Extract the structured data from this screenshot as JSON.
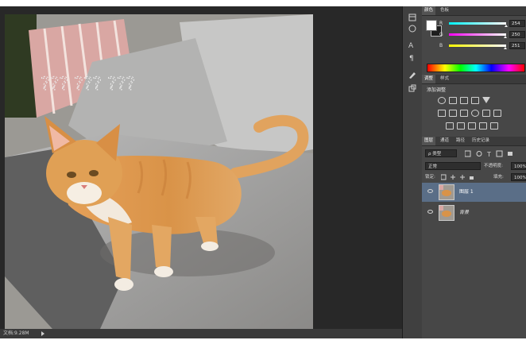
{
  "status": {
    "zoom_info": "文档:9.28M"
  },
  "color_panel": {
    "tabs": [
      "颜色",
      "色板"
    ],
    "foreground": "#ffffff",
    "background": "#1e1e1e",
    "sliders": [
      {
        "label": "R",
        "value": "254",
        "level": 0.996
      },
      {
        "label": "G",
        "value": "250",
        "level": 0.98
      },
      {
        "label": "B",
        "value": "251",
        "level": 0.984
      }
    ]
  },
  "adjustments_panel": {
    "tabs": [
      "调整",
      "样式"
    ],
    "title": "添加调整"
  },
  "layers_panel": {
    "tabs": [
      "图层",
      "通道",
      "路径",
      "历史记录"
    ],
    "filter_kind": "ρ 类型",
    "blend_mode": "正常",
    "opacity_label": "不透明度:",
    "opacity_value": "100%",
    "lock_label": "锁定:",
    "fill_label": "填充:",
    "fill_value": "100%",
    "layers": [
      {
        "name": "图层 1",
        "selected": true
      },
      {
        "name": "背景",
        "selected": false
      }
    ]
  },
  "watermark_text": "???   ???   ???",
  "colors": {
    "selection": "#5a6e87",
    "panel": "#474747",
    "canvas_bg": "#282828"
  }
}
